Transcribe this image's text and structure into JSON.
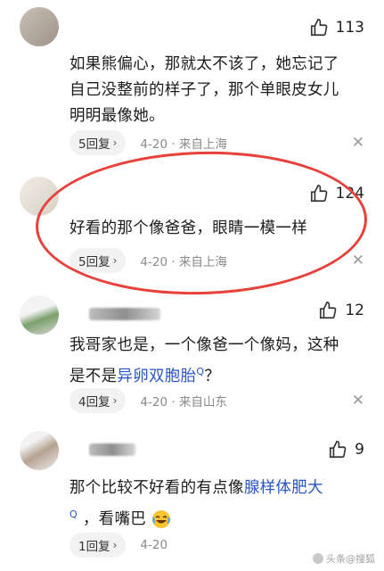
{
  "comments": [
    {
      "likes": "113",
      "text_lines": [
        "如果熊偏心，那就太不该了，她忘记了",
        "自己没整前的样子了，那个单眼皮女儿",
        "明明最像她。"
      ],
      "reply": "5回复",
      "meta": "4-20 · 来自上海",
      "close": "✕"
    },
    {
      "likes": "124",
      "text_lines": [
        "好看的那个像爸爸，眼睛一模一样"
      ],
      "reply": "5回复",
      "meta": "4-20 · 来自上海",
      "close": "✕"
    },
    {
      "likes": "12",
      "text_a": "我哥家也是，一个像爸一个像妈，这种",
      "text_b_prefix": "是不是",
      "text_b_link": "异卵双胞胎",
      "text_b_suffix": "？",
      "reply": "4回复",
      "meta": "4-20 · 来自山东",
      "close": "✕"
    },
    {
      "likes": "9",
      "text_a_prefix": "那个比较不好看的有点像",
      "text_a_link": "腺样体肥大",
      "text_b": "，看嘴巴",
      "reply": "1回复",
      "meta": "4-20",
      "close": "✕"
    }
  ],
  "icons": {
    "like": "thumbs-up-icon",
    "search": "search-mark-icon",
    "close": "close-icon",
    "chevron": "chevron-right-icon",
    "emoji": "crying-laughing-emoji-icon"
  },
  "search_mark": "Q",
  "chevron": "›",
  "watermark": "头条@搜狐",
  "colors": {
    "link": "#2a56c6",
    "ring": "#e8403a",
    "meta": "#8a8a8a"
  }
}
